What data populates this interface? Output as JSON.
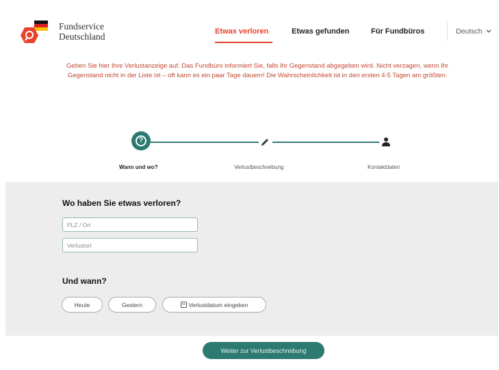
{
  "header": {
    "brand_line1": "Fundservice",
    "brand_line2": "Deutschland",
    "nav": [
      {
        "label": "Etwas verloren",
        "active": true
      },
      {
        "label": "Etwas gefunden",
        "active": false
      },
      {
        "label": "Für Fundbüros",
        "active": false
      }
    ],
    "language": "Deutsch",
    "colors": {
      "accent": "#e8412c",
      "primary": "#2c7a70"
    }
  },
  "intro": "Geben Sie hier Ihre Verlustanzeige auf. Das Fundbüro informiert Sie, falls Ihr Gegenstand abgegeben wird. Nicht verzagen, wenn Ihr Gegenstand nicht in der Liste ist – oft kann es ein paar Tage dauern! Die Wahrscheinlichkeit ist in den ersten 4-5 Tagen am größten.",
  "stepper": {
    "steps": [
      {
        "label": "Wann und wo?",
        "icon": "question-icon",
        "current": true
      },
      {
        "label": "Verlustbeschreibung",
        "icon": "pencil-icon",
        "current": false
      },
      {
        "label": "Kontaktdaten",
        "icon": "person-icon",
        "current": false
      }
    ]
  },
  "form": {
    "where_heading": "Wo haben Sie etwas verloren?",
    "plz_placeholder": "PLZ / Ort",
    "place_placeholder": "Verlustort",
    "when_heading": "Und wann?",
    "buttons": {
      "today": "Heute",
      "yesterday": "Gestern",
      "enter_date": "Verlustdatum eingeben"
    }
  },
  "cta": {
    "label": "Weiter zur Verlustbeschreibung"
  }
}
